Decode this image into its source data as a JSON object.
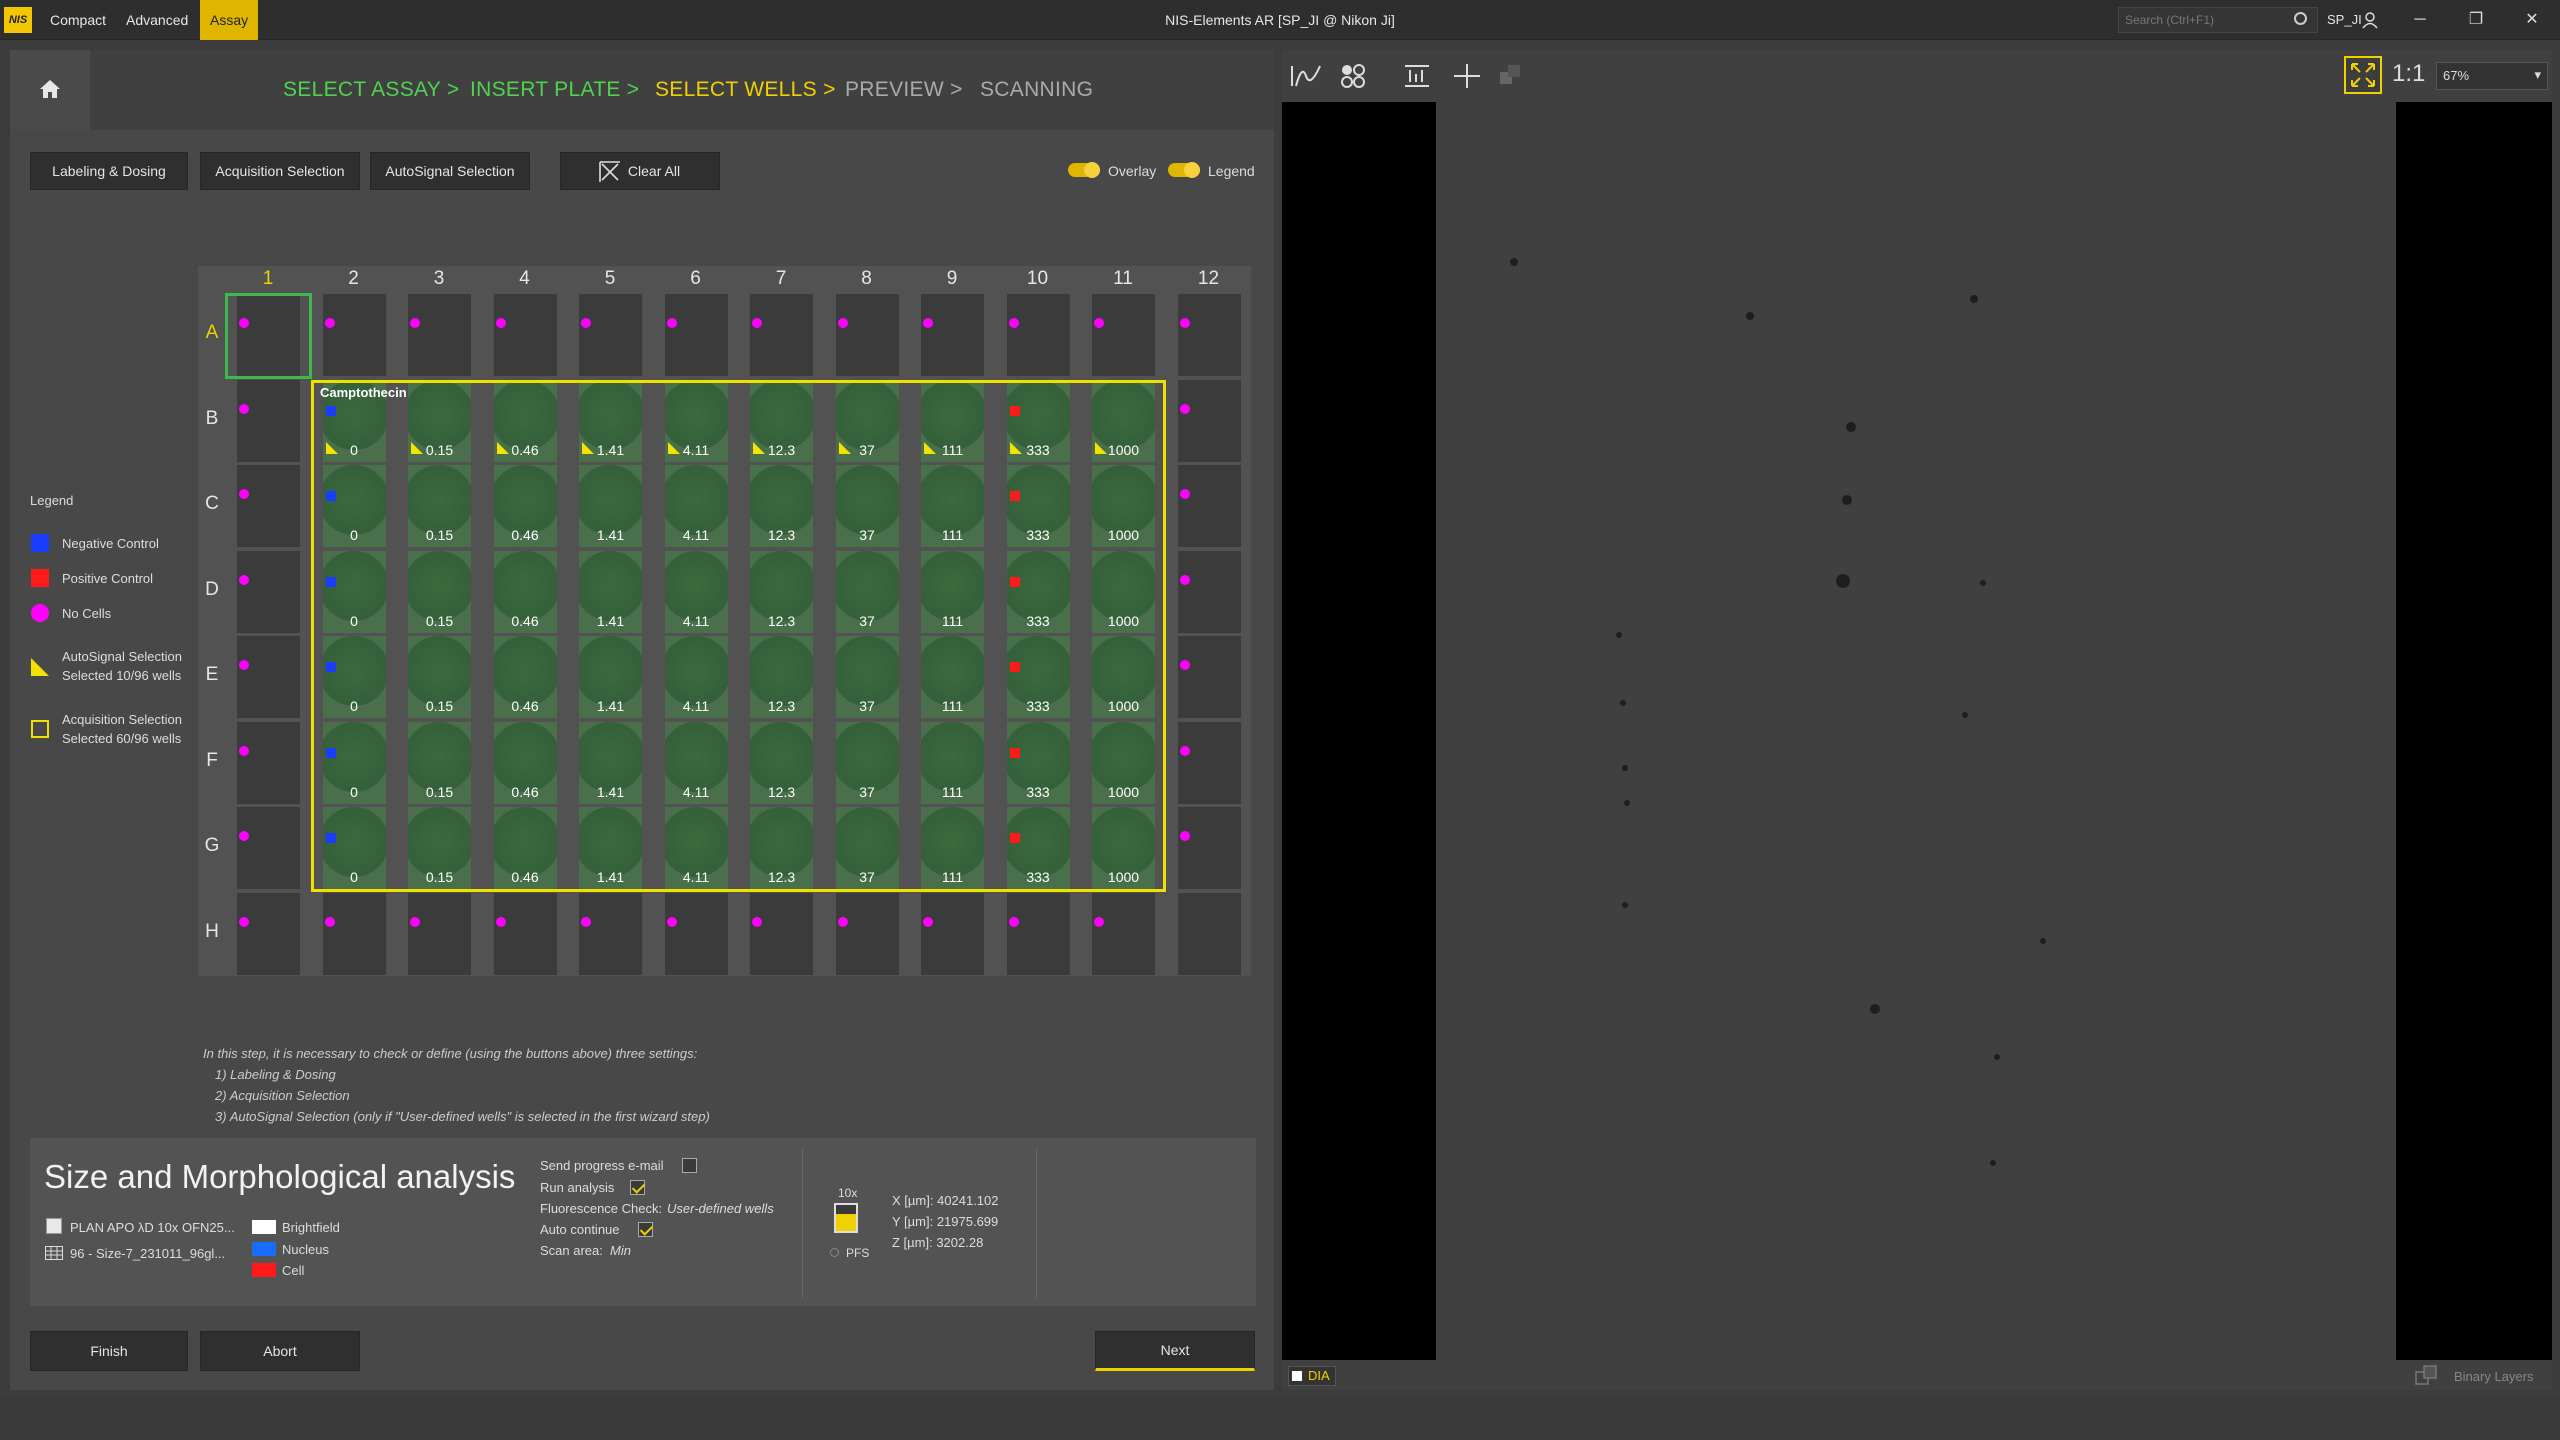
{
  "titlebar": {
    "logo": "NIS",
    "menu": [
      "Compact",
      "Advanced",
      "Assay"
    ],
    "title": "NIS-Elements AR [SP_JI @ Nikon Ji]",
    "search_placeholder": "Search (Ctrl+F1)",
    "user": "SP_JI",
    "controls": [
      "minimize-icon",
      "restore-icon",
      "close-icon"
    ]
  },
  "wizard": {
    "steps": [
      {
        "label": "SELECT ASSAY >",
        "state": "done"
      },
      {
        "label": "INSERT PLATE >",
        "state": "done"
      },
      {
        "label": "SELECT WELLS >",
        "state": "current"
      },
      {
        "label": "PREVIEW >",
        "state": "pending"
      },
      {
        "label": "SCANNING",
        "state": "pending"
      }
    ],
    "colors": {
      "done": "#4fd34f",
      "current": "#f0d000",
      "pending": "#aaaaaa"
    }
  },
  "toolbar": {
    "labeling": "Labeling & Dosing",
    "acquisition": "Acquisition Selection",
    "autosignal": "AutoSignal Selection",
    "clear_all": "Clear All",
    "overlay": "Overlay",
    "legend": "Legend"
  },
  "plate": {
    "columns": [
      "1",
      "2",
      "3",
      "4",
      "5",
      "6",
      "7",
      "8",
      "9",
      "10",
      "11",
      "12"
    ],
    "rows": [
      "A",
      "B",
      "C",
      "D",
      "E",
      "F",
      "G",
      "H"
    ],
    "compound": "Camptothecin",
    "concentrations": [
      "0",
      "0.15",
      "0.46",
      "1.41",
      "4.11",
      "12.3",
      "37",
      "111",
      "333",
      "1000"
    ],
    "colors": {
      "negative": "#1a3cff",
      "positive": "#ff1a1a",
      "no_cells": "#ff00ff",
      "autosignal": "#f4e300",
      "acquisition": "#f0e000",
      "current_well": "#3db84a"
    }
  },
  "legend": {
    "title": "Legend",
    "items": [
      {
        "label": "Negative Control",
        "icon": "blue-square"
      },
      {
        "label": "Positive Control",
        "icon": "red-square"
      },
      {
        "label": "No Cells",
        "icon": "magenta-dot"
      },
      {
        "label": "AutoSignal Selection",
        "sub": "Selected 10/96 wells",
        "icon": "yellow-triangle"
      },
      {
        "label": "Acquisition Selection",
        "sub": "Selected 60/96 wells",
        "icon": "yellow-square-outline"
      }
    ]
  },
  "instructions": {
    "intro": "In this step, it is necessary to check or define (using the buttons above) three settings:",
    "items": [
      "1) Labeling & Dosing",
      "2) Acquisition Selection",
      "3) AutoSignal Selection (only if \"User-defined wells\" is selected in the first wizard step)"
    ]
  },
  "info": {
    "assay_name": "Size and Morphological analysis",
    "objective": "PLAN APO λD 10x OFN25...",
    "plate": "96 - Size-7_231011_96gl...",
    "channels": [
      {
        "name": "Brightfield",
        "color": "#ffffff"
      },
      {
        "name": "Nucleus",
        "color": "#1a6cff"
      },
      {
        "name": "Cell",
        "color": "#ff1a1a"
      }
    ],
    "send_email": "Send progress e-mail",
    "run_analysis": "Run analysis",
    "fluor_check": "Fluorescence Check:",
    "fluor_value": "User-defined wells",
    "auto_continue": "Auto continue",
    "scan_area": "Scan area:",
    "scan_value": "Min",
    "magnification": "10x",
    "pfs": "PFS",
    "x": "X [µm]: 40241.102",
    "y": "Y [µm]: 21975.699",
    "z": "Z [µm]: 3202.28"
  },
  "buttons": {
    "finish": "Finish",
    "abort": "Abort",
    "next": "Next"
  },
  "viewer": {
    "zoom": "67%",
    "ratio": "1:1",
    "channel": "DIA",
    "binary_layers": "Binary Layers"
  }
}
